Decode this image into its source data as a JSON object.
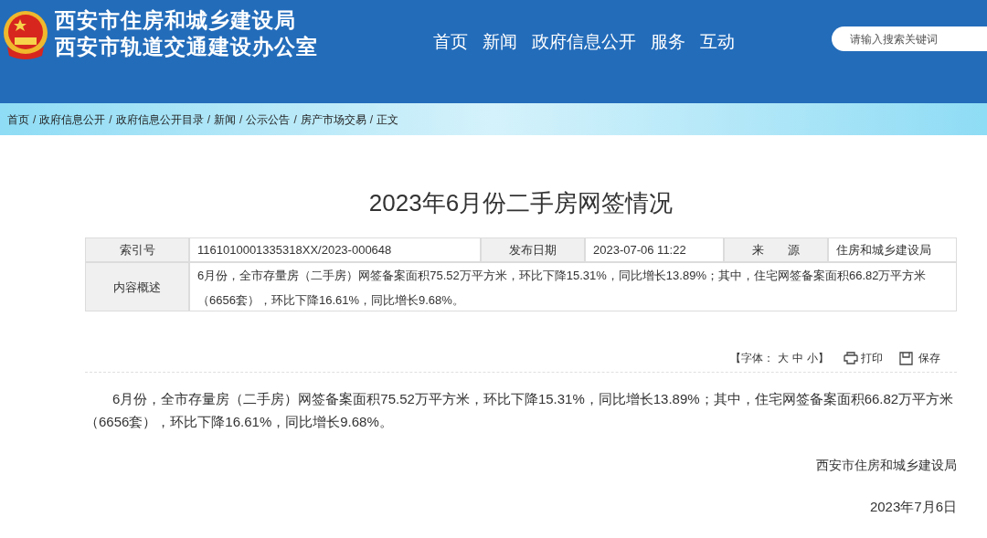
{
  "header": {
    "titles": [
      "西安市住房和城乡建设局",
      "西安市轨道交通建设办公室"
    ],
    "nav": [
      "首页",
      "新闻",
      "政府信息公开",
      "服务",
      "互动"
    ],
    "search": {
      "placeholder": "请输入搜索关键词"
    }
  },
  "breadcrumb_separator": "/",
  "breadcrumb": [
    "首页",
    "政府信息公开",
    "政府信息公开目录",
    "新闻",
    "公示公告",
    "房产市场交易",
    "正文"
  ],
  "article": {
    "title": "2023年6月份二手房网签情况",
    "meta": {
      "index_label": "索引号",
      "index_value": "1161010001335318XX/2023-000648",
      "date_label": "发布日期",
      "date_value": "2023-07-06 11:22",
      "source_label": "来　　源",
      "source_value": "住房和城乡建设局",
      "summary_label": "内容概述",
      "summary_value": "6月份，全市存量房（二手房）网签备案面积75.52万平方米，环比下降15.31%，同比增长13.89%；其中，住宅网签备案面积66.82万平方米（6656套），环比下降16.61%，同比增长9.68%。"
    },
    "tools": {
      "font_open": "【字体：",
      "font_sizes": [
        "大",
        "中",
        "小"
      ],
      "font_close": "】",
      "print": "打印",
      "save": "保存"
    },
    "body": "6月份，全市存量房（二手房）网签备案面积75.52万平方米，环比下降15.31%，同比增长13.89%；其中，住宅网签备案面积66.82万平方米（6656套），环比下降16.61%，同比增长9.68%。",
    "signature": "西安市住房和城乡建设局",
    "date": "2023年7月6日"
  }
}
